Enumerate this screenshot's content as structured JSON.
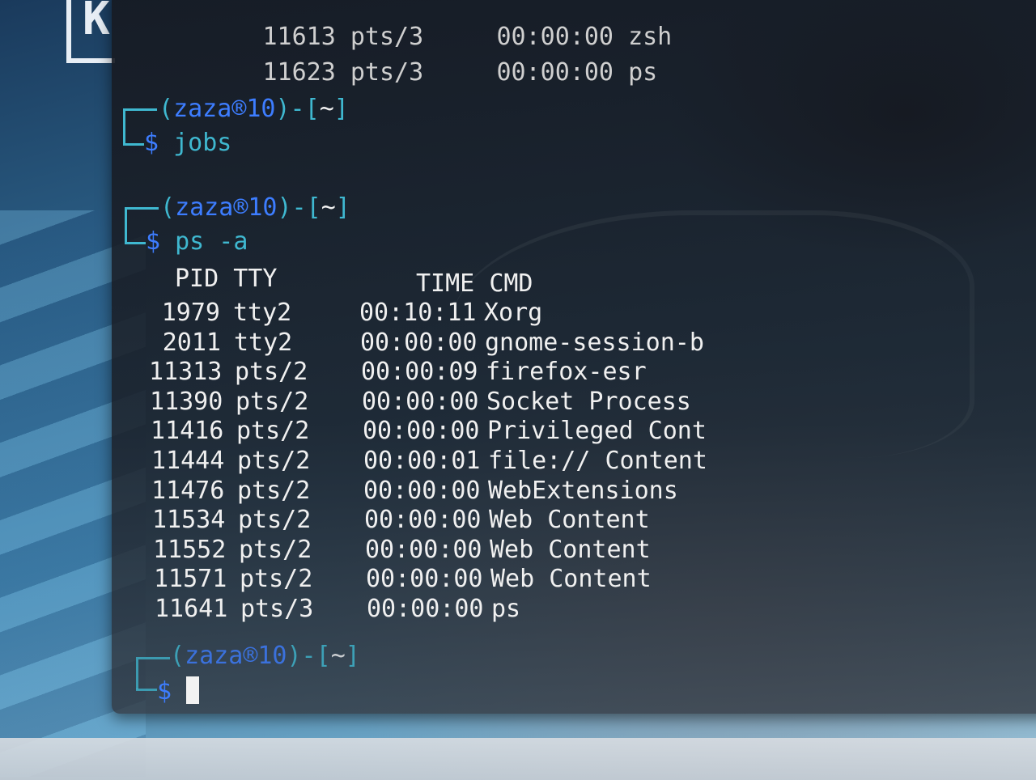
{
  "previous_output": [
    {
      "pid": "11613",
      "tty": "pts/3",
      "time": "00:00:00",
      "cmd": "zsh"
    },
    {
      "pid": "11623",
      "tty": "pts/3",
      "time": "00:00:00",
      "cmd": "ps"
    }
  ],
  "prompt": {
    "open": "(",
    "user": "zaza",
    "at_symbol": "®",
    "host": "10",
    "mid": ")-[",
    "dir": "~",
    "close": "]",
    "symbol": "$"
  },
  "commands": [
    "jobs",
    "ps -a"
  ],
  "ps_table": {
    "headers": {
      "pid": "PID",
      "tty": "TTY",
      "time": "TIME",
      "cmd": "CMD"
    },
    "rows": [
      {
        "pid": "1979",
        "tty": "tty2",
        "time": "00:10:11",
        "cmd": "Xorg"
      },
      {
        "pid": "2011",
        "tty": "tty2",
        "time": "00:00:00",
        "cmd": "gnome-session-b"
      },
      {
        "pid": "11313",
        "tty": "pts/2",
        "time": "00:00:09",
        "cmd": "firefox-esr"
      },
      {
        "pid": "11390",
        "tty": "pts/2",
        "time": "00:00:00",
        "cmd": "Socket Process"
      },
      {
        "pid": "11416",
        "tty": "pts/2",
        "time": "00:00:00",
        "cmd": "Privileged Cont"
      },
      {
        "pid": "11444",
        "tty": "pts/2",
        "time": "00:00:01",
        "cmd": "file:// Content"
      },
      {
        "pid": "11476",
        "tty": "pts/2",
        "time": "00:00:00",
        "cmd": "WebExtensions"
      },
      {
        "pid": "11534",
        "tty": "pts/2",
        "time": "00:00:00",
        "cmd": "Web Content"
      },
      {
        "pid": "11552",
        "tty": "pts/2",
        "time": "00:00:00",
        "cmd": "Web Content"
      },
      {
        "pid": "11571",
        "tty": "pts/2",
        "time": "00:00:00",
        "cmd": "Web Content"
      },
      {
        "pid": "11641",
        "tty": "pts/3",
        "time": "00:00:00",
        "cmd": "ps"
      }
    ]
  },
  "colors": {
    "prompt_user": "#3d7dff",
    "prompt_frame": "#3fb8d0",
    "text": "#e6e6e6",
    "terminal_bg": "#161a22"
  },
  "icons": {
    "corner_logo": "kali-logo-icon",
    "cursor": "block-cursor"
  },
  "corner_logo_letter": "K"
}
